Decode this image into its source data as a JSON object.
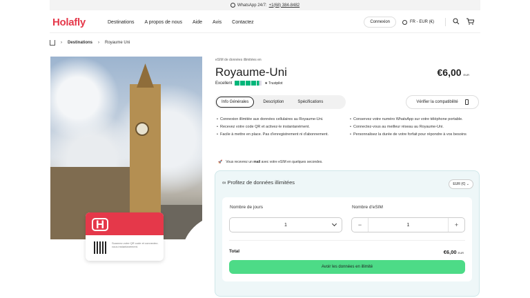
{
  "topbar": {
    "prefix": "WhatsApp 24/7:",
    "phone": "+1(68) 384-8482"
  },
  "nav": {
    "logo": "Holafly",
    "menu": [
      "Destinations",
      "A propos de nous",
      "Aide",
      "Avis",
      "Contactez"
    ],
    "login": "Connexion",
    "lang": "FR - EUR (€)"
  },
  "breadcrumb": {
    "items": [
      "Destinations",
      "Royaume Uni"
    ]
  },
  "product": {
    "subtitle": "eSIM de données illimitées en",
    "title": "Royaume-Uni",
    "price": "€6,00",
    "price_currency": "EUR",
    "rating_label": "Excellent",
    "trustpilot": "Trustpilot",
    "tabs": [
      "Info Générales",
      "Description",
      "Spécifications"
    ],
    "verify": "Vérifier la compatibilité"
  },
  "features": {
    "left": [
      "Connexion illimitée aux données cellulaires au Royaume-Uni.",
      "Recevez votre code QR et activez-le instantanément.",
      "Facile à mettre en place. Pas d'enregistrement ni d'abonnement."
    ],
    "right": [
      "Conservez votre numéro WhatsApp sur votre téléphone portable.",
      "Connectez-vous au meilleur réseau au Royaume-Uni.",
      "Personnalisez la durée de votre forfait pour répondre à vos besoins"
    ]
  },
  "mail_note": {
    "pre": "Vous recevrez un ",
    "bold": "mail",
    "post": " avec votre eSIM en quelques secondes."
  },
  "esim_card": {
    "text": "Scannez votre QR code et connectez-vous instantanément."
  },
  "panel": {
    "heading": "Profitez de données illimitées",
    "currency": "EUR (€)",
    "days_label": "Nombre de jours",
    "days_value": "1",
    "esim_label": "Nombre d'eSIM",
    "esim_value": "1",
    "minus": "−",
    "plus": "+",
    "total_label": "Total",
    "total_value": "€6,00",
    "total_currency": "EUR",
    "cta": "Avoir les données en illimité"
  },
  "colors": {
    "brand": "#e5384a",
    "cta": "#4ddb87",
    "trust": "#00b67a",
    "panel": "#eef7f8"
  }
}
